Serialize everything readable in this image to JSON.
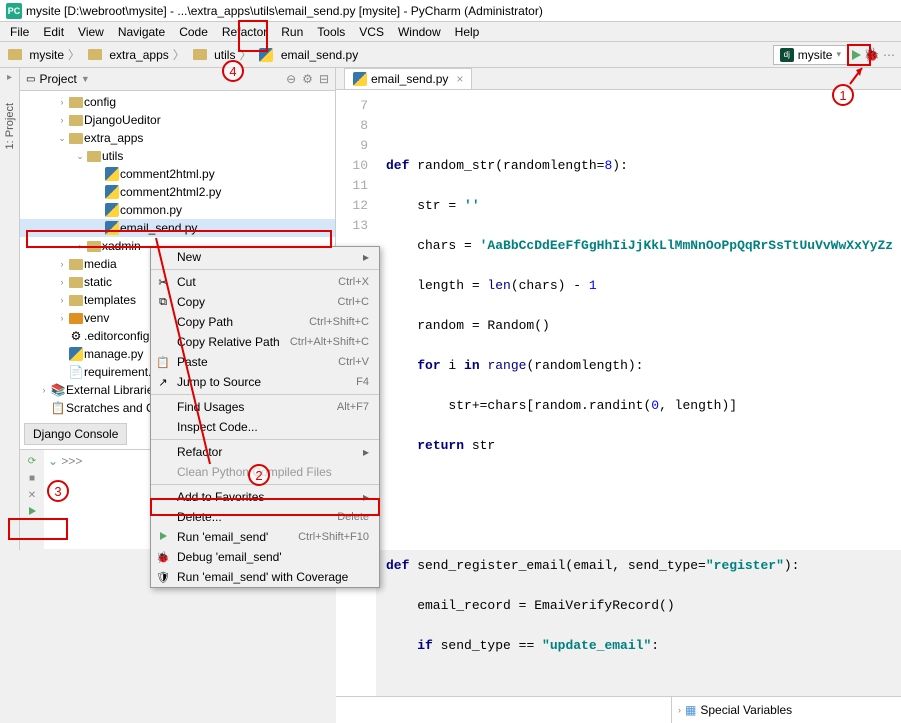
{
  "window": {
    "title": "mysite [D:\\webroot\\mysite] - ...\\extra_apps\\utils\\email_send.py [mysite] - PyCharm (Administrator)"
  },
  "menubar": [
    "File",
    "Edit",
    "View",
    "Navigate",
    "Code",
    "Refactor",
    "Run",
    "Tools",
    "VCS",
    "Window",
    "Help"
  ],
  "breadcrumbs": [
    "mysite",
    "extra_apps",
    "utils",
    "email_send.py"
  ],
  "run_config": {
    "name": "mysite",
    "dropdown": "▾"
  },
  "project": {
    "title": "Project",
    "dropdown": "▼",
    "tree": {
      "config": "config",
      "django_ueditor": "DjangoUeditor",
      "extra_apps": "extra_apps",
      "utils": "utils",
      "comment2html": "comment2html.py",
      "comment2html2": "comment2html2.py",
      "common": "common.py",
      "email_send": "email_send.py",
      "xadmin": "xadmin",
      "media": "media",
      "static": "static",
      "templates": "templates",
      "venv": "venv",
      "editorconfig": ".editorconfig",
      "manage": "manage.py",
      "requirement": "requirement.txt",
      "external": "External Libraries",
      "scratches": "Scratches and Consoles"
    }
  },
  "django_console": "Django Console",
  "console_prompt": ">>>",
  "editor": {
    "tab": "email_send.py",
    "lines": [
      "7",
      "8",
      "9",
      "10",
      "11",
      "12",
      "13"
    ],
    "code": {
      "l8a": "def",
      "l8b": " random_str(randomlength=",
      "l8num": "8",
      "l8c": "):",
      "l9a": "    str = ",
      "l9str": "''",
      "l10a": "    chars = ",
      "l10str": "'AaBbCcDdEeFfGgHhIiJjKkLlMmNnOoPpQqRrSsTtUuVvWwXxYyZz",
      "l11a": "    length = ",
      "l11b": "len",
      "l11c": "(chars) - ",
      "l11num": "1",
      "l12a": "    random = Random()",
      "l13a": "    ",
      "l13kw": "for",
      "l13b": " i ",
      "l13kw2": "in",
      "l13c": " ",
      "l13d": "range",
      "l13e": "(randomlength):",
      "l14a": "        str+=chars[random.randint(",
      "l14num1": "0",
      "l14b": ", length)]",
      "l15a": "    ",
      "l15kw": "return",
      "l15b": " str",
      "l18a": "def",
      "l18b": " send_register_email(email, send_type=",
      "l18str": "\"register\"",
      "l18c": "):",
      "l19a": "    email_record = EmaiVerifyRecord()",
      "l20a": "    ",
      "l20kw": "if",
      "l20b": " send_type == ",
      "l20str": "\"update_email\"",
      "l20c": ":"
    }
  },
  "special_vars": {
    "label": "Special Variables"
  },
  "context_menu": {
    "new": "New",
    "cut": "Cut",
    "cut_sc": "Ctrl+X",
    "copy": "Copy",
    "copy_sc": "Ctrl+C",
    "copy_path": "Copy Path",
    "copy_path_sc": "Ctrl+Shift+C",
    "copy_rel": "Copy Relative Path",
    "copy_rel_sc": "Ctrl+Alt+Shift+C",
    "paste": "Paste",
    "paste_sc": "Ctrl+V",
    "jump": "Jump to Source",
    "jump_sc": "F4",
    "find_usages": "Find Usages",
    "find_usages_sc": "Alt+F7",
    "inspect": "Inspect Code...",
    "refactor": "Refactor",
    "clean": "Clean Python Compiled Files",
    "fav": "Add to Favorites",
    "delete": "Delete...",
    "delete_sc": "Delete",
    "run": "Run 'email_send'",
    "run_sc": "Ctrl+Shift+F10",
    "debug": "Debug 'email_send'",
    "coverage": "Run 'email_send' with Coverage"
  },
  "annotations": {
    "a1": "1",
    "a2": "2",
    "a3": "3",
    "a4": "4"
  },
  "sidebar_label": "1: Project"
}
